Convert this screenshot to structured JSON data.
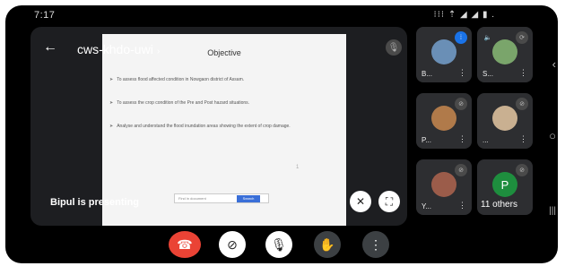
{
  "status_bar": {
    "time": "7:17",
    "icons": "⊙ ▣ ▣ •",
    "right": "⁝⁝⁝ ⇡ ◢ ◢ ▮ ."
  },
  "meeting": {
    "code": "cws-khdo-uwi",
    "back_icon": "arrow-left-icon",
    "presenter_text": "Bipul is presenting"
  },
  "slide": {
    "heading": "Objective",
    "bullets": [
      "To assess flood affected condition in Nowgaon district of Assam.",
      "To assess the crop condition of the Pre and Post hazard situations.",
      "Analyse and understand the flood inundation areas showing the extent of crop damage."
    ],
    "page_marker": "1",
    "find_placeholder": "Find in document",
    "find_button": "Search"
  },
  "participants": [
    {
      "label": "B...",
      "color": "#6a8fb6"
    },
    {
      "label": "S...",
      "color": "#7aa56b"
    },
    {
      "label": "P...",
      "color": "#b07a4a"
    },
    {
      "label": "...",
      "color": "#c9b091"
    },
    {
      "label": "Y...",
      "color": "#9b5c4a"
    }
  ],
  "others": {
    "initial": "P",
    "label": "11 others"
  },
  "controls": {
    "end": "☎",
    "camera": "⊘",
    "mic": "🎙",
    "hand": "✋",
    "more": "⋮"
  },
  "nav": {
    "back": "‹",
    "home": "○",
    "recent": "|||"
  }
}
